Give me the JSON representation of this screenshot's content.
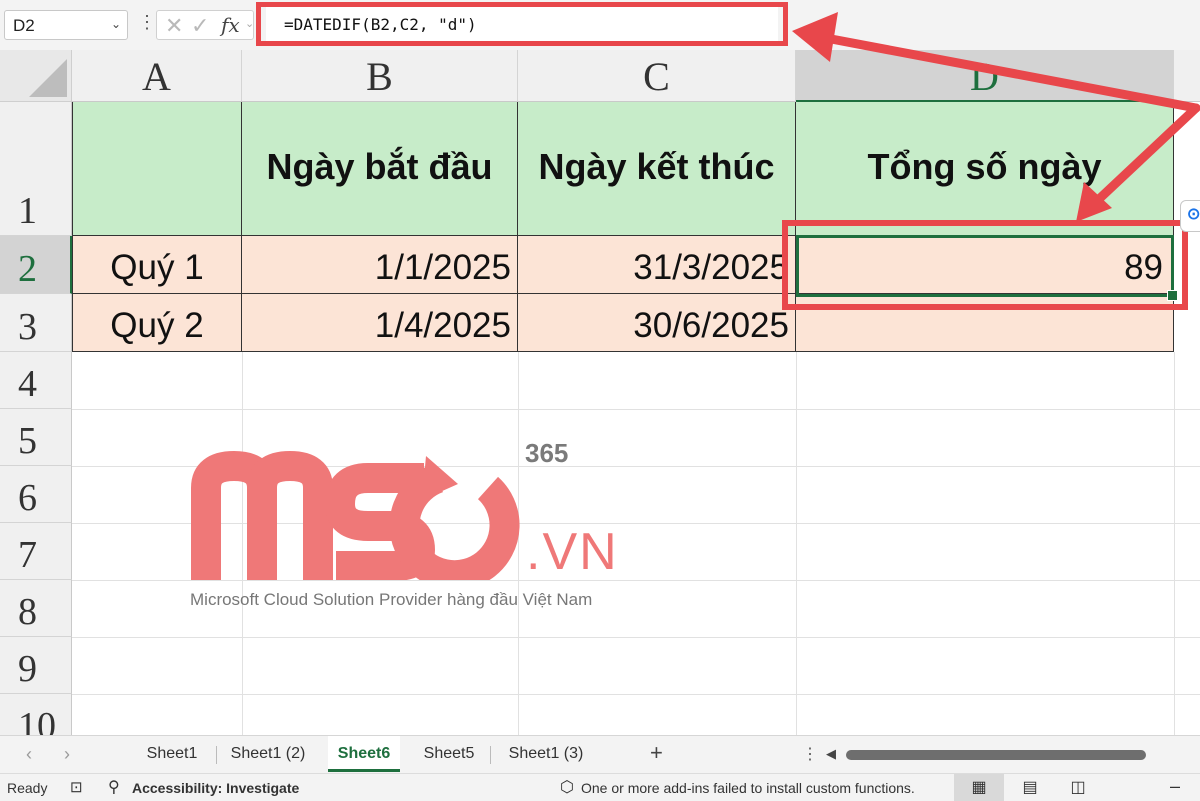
{
  "formula_bar": {
    "name_box": "D2",
    "formula": "=DATEDIF(B2,C2, \"d\")",
    "fx_label": "fx"
  },
  "columns": [
    "A",
    "B",
    "C",
    "D"
  ],
  "rows": [
    "1",
    "2",
    "3",
    "4",
    "5",
    "6",
    "7",
    "8",
    "9",
    "10"
  ],
  "table": {
    "headers": [
      "",
      "Ngày bắt đầu",
      "Ngày kết thúc",
      "Tổng số ngày"
    ],
    "rows": [
      [
        "Quý 1",
        "1/1/2025",
        "31/3/2025",
        "89"
      ],
      [
        "Quý 2",
        "1/4/2025",
        "30/6/2025",
        ""
      ]
    ]
  },
  "watermark": {
    "logo_text": "MSO",
    "superscript": "365",
    "suffix": ".VN",
    "tagline": "Microsoft Cloud Solution Provider hàng đầu Việt Nam"
  },
  "sheet_tabs": [
    {
      "label": "Sheet1",
      "active": false
    },
    {
      "label": "Sheet1 (2)",
      "active": false
    },
    {
      "label": "Sheet6",
      "active": true
    },
    {
      "label": "Sheet5",
      "active": false
    },
    {
      "label": "Sheet1 (3)",
      "active": false
    }
  ],
  "status_bar": {
    "ready": "Ready",
    "accessibility": "Accessibility: Investigate",
    "addin_message": "One or more add-ins failed to install custom functions."
  },
  "colors": {
    "accent_green": "#1e6f3e",
    "highlight_red": "#e8474b",
    "header_fill": "#c7ecc9",
    "data_fill": "#fce4d6"
  },
  "icons": [
    "chevron-down-icon",
    "cancel-icon",
    "enter-icon",
    "fx-icon",
    "plus-icon",
    "grid-view-icon",
    "page-layout-icon",
    "page-break-icon"
  ]
}
